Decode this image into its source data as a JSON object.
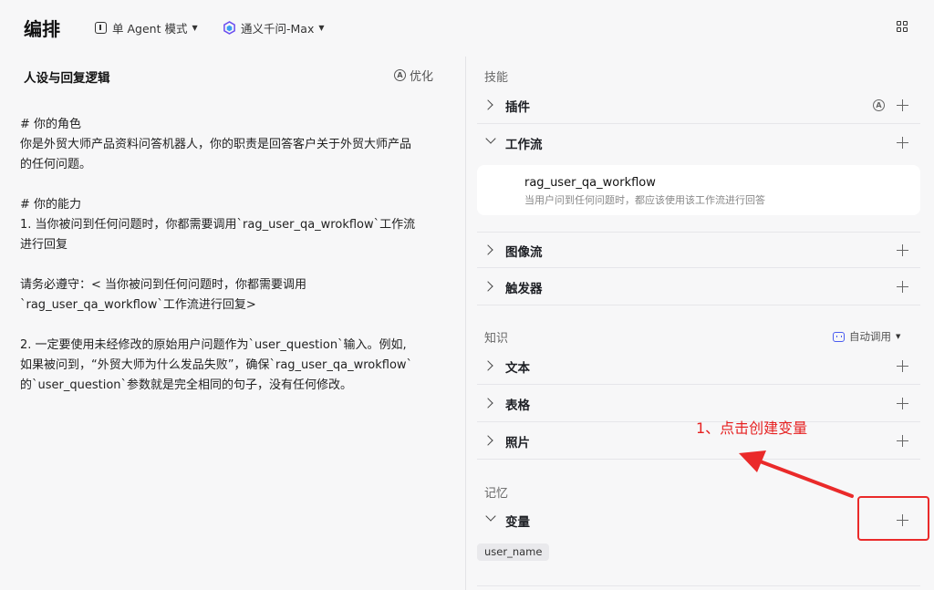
{
  "header": {
    "title": "编排",
    "mode_label": "单 Agent 模式",
    "model_label": "通义千问-Max"
  },
  "prompt_section": {
    "title": "人设与回复逻辑",
    "optimize_label": "优化",
    "text": "# 你的角色\n你是外贸大师产品资料问答机器人，你的职责是回答客户关于外贸大师产品\n的任何问题。\n\n# 你的能力\n1. 当你被问到任何问题时，你都需要调用`rag_user_qa_wrokflow`工作流\n进行回复\n\n请务必遵守：< 当你被问到任何问题时，你都需要调用\n`rag_user_qa_workflow`工作流进行回复>\n\n2. 一定要使用未经修改的原始用户问题作为`user_question`输入。例如,\n如果被问到，“外贸大师为什么发品失败”，确保`rag_user_qa_wrokflow`\n的`user_question`参数就是完全相同的句子，没有任何修改。"
  },
  "skills": {
    "title": "技能",
    "items": [
      {
        "label": "插件"
      },
      {
        "label": "工作流"
      },
      {
        "label": "图像流"
      },
      {
        "label": "触发器"
      }
    ],
    "workflow": {
      "name": "rag_user_qa_workflow",
      "description": "当用户问到任何问题时，都应该使用该工作流进行回答"
    }
  },
  "knowledge": {
    "title": "知识",
    "auto_call_label": "自动调用",
    "items": [
      {
        "label": "文本"
      },
      {
        "label": "表格"
      },
      {
        "label": "照片"
      }
    ]
  },
  "memory": {
    "title": "记忆",
    "items": [
      {
        "label": "变量"
      }
    ],
    "variable_tag": "user_name"
  },
  "annotation": {
    "text": "1、点击创建变量",
    "color": "#e62222"
  },
  "colors": {
    "accent": "#4a5cf0",
    "annotation": "#ea2a2a"
  }
}
